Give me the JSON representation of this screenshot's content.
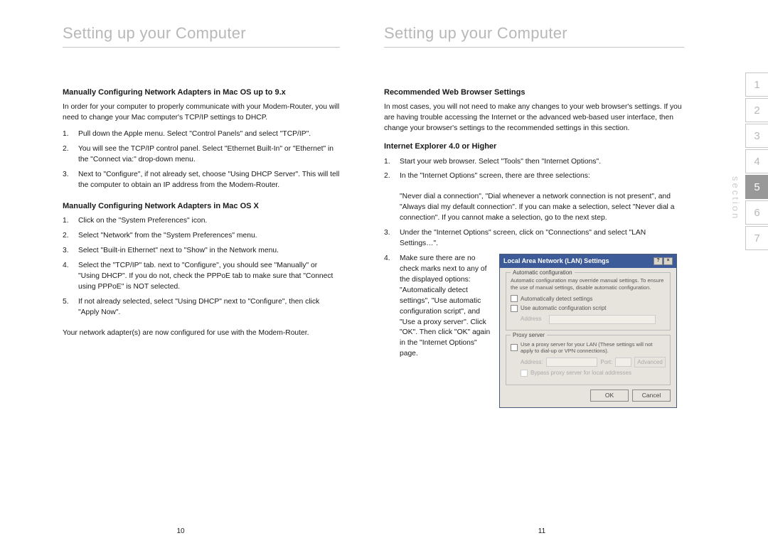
{
  "left": {
    "header": "Setting up your Computer",
    "sec1_title": "Manually Configuring Network Adapters in Mac OS up to 9.x",
    "sec1_intro": "In order for your computer to properly communicate with your Modem-Router, you will need to change your Mac computer's TCP/IP settings to DHCP.",
    "sec1_items": [
      "Pull down the Apple menu. Select \"Control Panels\" and select \"TCP/IP\".",
      "You will see the TCP/IP control panel. Select \"Ethernet Built-In\" or \"Ethernet\" in the \"Connect via:\" drop-down menu.",
      "Next to \"Configure\", if not already set, choose \"Using DHCP Server\". This will tell the computer to obtain an IP address from the Modem-Router."
    ],
    "sec2_title": "Manually Configuring Network Adapters in Mac OS X",
    "sec2_items": [
      "Click on the \"System Preferences\" icon.",
      "Select \"Network\" from the \"System Preferences\" menu.",
      "Select \"Built-in Ethernet\" next to \"Show\" in the Network menu.",
      "Select the \"TCP/IP\" tab. next to \"Configure\", you should see \"Manually\" or \"Using DHCP\". If you do not, check the PPPoE tab to make sure that \"Connect using PPPoE\" is NOT selected.",
      "If not already selected, select \"Using DHCP\" next to \"Configure\", then click \"Apply Now\"."
    ],
    "sec2_outro": "Your network adapter(s) are now configured for use with the Modem-Router.",
    "pagenum": "10"
  },
  "right": {
    "header": "Setting up your Computer",
    "sec1_title": "Recommended Web Browser Settings",
    "sec1_intro": "In most cases, you will not need to make any changes to your web browser's settings. If you are having trouble accessing the Internet or the advanced web-based user interface, then change your browser's settings to the recommended settings in this section.",
    "ie_title": "Internet Explorer 4.0 or Higher",
    "ie_items": [
      "Start your web browser. Select \"Tools\" then \"Internet Options\".",
      "In the \"Internet Options\" screen, there are three selections:"
    ],
    "ie_quote": "\"Never dial a connection\", \"Dial whenever a network connection is not present\", and \"Always dial my default connection\". If you can make a selection, select \"Never dial a connection\". If you cannot make a selection, go to the next step.",
    "ie_item3": "Under the \"Internet Options\" screen, click on \"Connections\" and select \"LAN Settings…\".",
    "ie_item4": "Make sure there are no check marks next to any of the displayed options: \"Automatically detect settings\", \"Use automatic configuration script\", and \"Use a proxy server\". Click \"OK\". Then click \"OK\" again in the \"Internet Options\" page.",
    "dialog": {
      "title": "Local Area Network (LAN) Settings",
      "auto_legend": "Automatic configuration",
      "auto_note": "Automatic configuration may override manual settings. To ensure the use of manual settings, disable automatic configuration.",
      "chk1": "Automatically detect settings",
      "chk2": "Use automatic configuration script",
      "addr_label": "Address",
      "proxy_legend": "Proxy server",
      "proxy_note": "Use a proxy server for your LAN (These settings will not apply to dial-up or VPN connections).",
      "addr2": "Address:",
      "port": "Port:",
      "adv": "Advanced",
      "bypass": "Bypass proxy server for local addresses",
      "ok": "OK",
      "cancel": "Cancel"
    },
    "pagenum": "11"
  },
  "tabs": [
    "1",
    "2",
    "3",
    "4",
    "5",
    "6",
    "7"
  ],
  "tab_active": "5",
  "section_label": "section"
}
